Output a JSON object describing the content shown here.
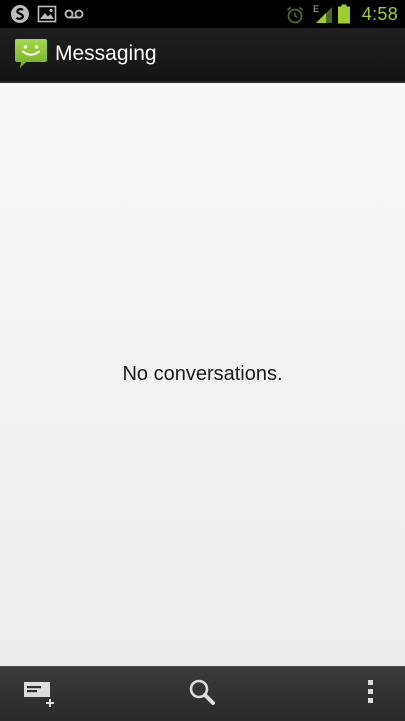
{
  "status_bar": {
    "time": "4:58",
    "network_type": "E",
    "left_icons": [
      "s-voice-icon",
      "gallery-image-icon",
      "voicemail-icon"
    ],
    "right_icons": [
      "alarm-icon",
      "signal-icon",
      "battery-icon"
    ],
    "accent_color": "#9fce2c"
  },
  "action_bar": {
    "title": "Messaging",
    "icon": "messaging-smiley-icon",
    "icon_color": "#8cc63f"
  },
  "main": {
    "empty_message": "No conversations."
  },
  "bottom_bar": {
    "buttons": [
      {
        "icon": "compose-message-icon"
      },
      {
        "icon": "search-icon"
      },
      {
        "icon": "overflow-menu-icon"
      }
    ]
  }
}
